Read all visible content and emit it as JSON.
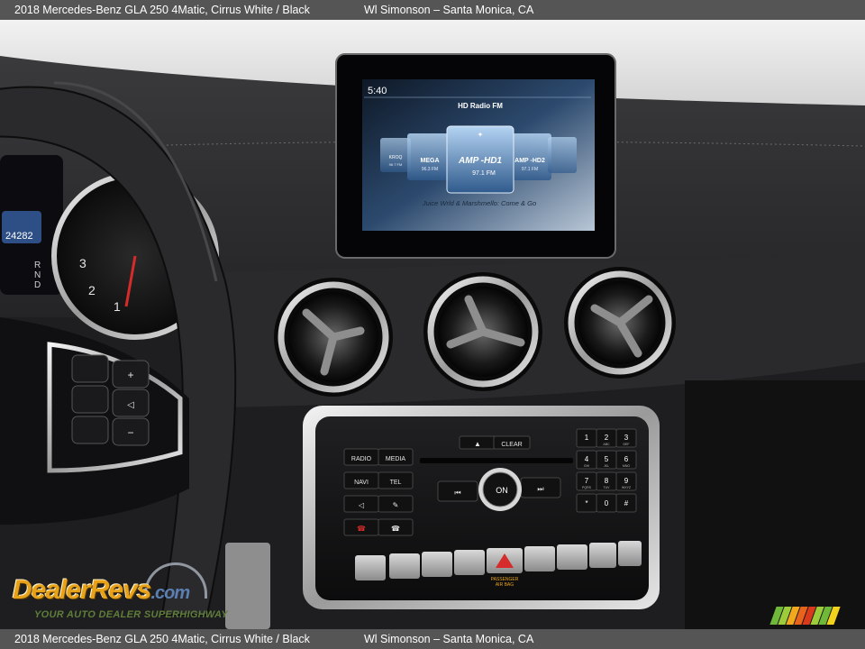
{
  "caption": {
    "title": "2018 Mercedes-Benz GLA 250 4Matic,  Cirrus White / Black",
    "dealer": "Wl Simonson – Santa Monica, CA"
  },
  "infotainment": {
    "clock": "5:40",
    "source_title": "HD Radio FM",
    "stations": [
      {
        "name": "KROQ",
        "freq": "96.7 FM"
      },
      {
        "name": "MEGA",
        "freq": "96.3 FM"
      },
      {
        "name": "AMP -HD1",
        "freq": "97.1 FM"
      },
      {
        "name": "AMP -HD2",
        "freq": "97.1 FM"
      },
      {
        "name": "",
        "freq": ""
      }
    ],
    "now_playing": "Juice Wrld & Marshmello: Come & Go"
  },
  "cluster": {
    "odometer": "24282",
    "gear_indicator": [
      "R",
      "N",
      "D"
    ],
    "tach_numbers": [
      "3",
      "2",
      "1"
    ]
  },
  "control_panel": {
    "left_buttons": [
      "RADIO",
      "MEDIA",
      "NAVI",
      "TEL"
    ],
    "eject_clear": "CLEAR",
    "knob_label": "ON",
    "keypad": [
      {
        "num": "1",
        "sub": ""
      },
      {
        "num": "2",
        "sub": "ABC"
      },
      {
        "num": "3",
        "sub": "DEF"
      },
      {
        "num": "4",
        "sub": "GHI"
      },
      {
        "num": "5",
        "sub": "JKL"
      },
      {
        "num": "6",
        "sub": "MNO"
      },
      {
        "num": "7",
        "sub": "PQRS"
      },
      {
        "num": "8",
        "sub": "TUV"
      },
      {
        "num": "9",
        "sub": "WXYZ"
      },
      {
        "num": "*",
        "sub": ""
      },
      {
        "num": "0",
        "sub": ""
      },
      {
        "num": "#",
        "sub": ""
      }
    ],
    "airbag_label_line1": "PASSENGER",
    "airbag_label_line2": "AIR BAG"
  },
  "watermark": {
    "brand": "DealerRevs",
    "suffix": ".com",
    "tagline": "YOUR AUTO DEALER SUPERHIGHWAY"
  },
  "colors": {
    "caption_bar": "#555555",
    "dash": "#1c1c1e",
    "screen_glow": "#8fb8e6",
    "hazard": "#d62b2b",
    "brand_orange": "#e8a21a"
  },
  "stripe_colors": [
    "#6fb83a",
    "#9ccc3a",
    "#f2a81d",
    "#e8641c",
    "#d93a1c",
    "#9ccc3a",
    "#6fb83a",
    "#f2d21d"
  ]
}
